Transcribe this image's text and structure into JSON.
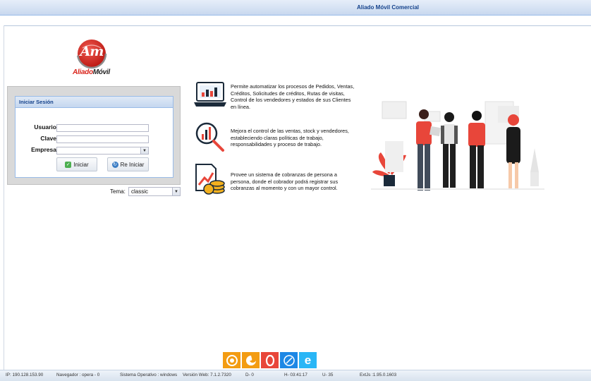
{
  "window": {
    "title": "Aliado Móvil Comercial"
  },
  "logo": {
    "monogram": "Am",
    "text_a": "Aliado",
    "text_b": "Móvil"
  },
  "login": {
    "panel_title": "Iniciar Sesión",
    "user_label": "Usuario",
    "user_value": "",
    "pass_label": "Clave",
    "pass_value": "",
    "company_label": "Empresa",
    "company_value": "",
    "start_button": "Iniciar",
    "restart_button": "Re Iniciar",
    "theme_label": "Tema:",
    "theme_value": "classic"
  },
  "features": [
    {
      "icon": "laptop-chart-icon",
      "text": "Permite automatizar los procesos de Pedidos, Ventas, Créditos, Solicitudes de créditos, Rutas de visitas, Control de los vendedores y estados de sus Clientes en línea."
    },
    {
      "icon": "magnifier-chart-icon",
      "text": "Mejora el control de las ventas, stock y vendedores, estableciendo claras políticas de trabajo, responsabilidades y proceso de trabajo."
    },
    {
      "icon": "invoice-coins-icon",
      "text": "Provee un sistema de cobranzas de persona a persona, donde el cobrador podrá registrar sus cobranzas al momento y con un mayor control."
    }
  ],
  "colors": {
    "accent": "#15428b",
    "brand_red": "#d9251c",
    "footer_bg": "#dde6f1"
  },
  "browsers": [
    "chrome-icon",
    "firefox-icon",
    "opera-icon",
    "safari-icon",
    "edge-icon"
  ],
  "footer": {
    "ip": "IP: 190.128.153.90",
    "browser": "Navegador : opera - 0",
    "os": "Sistema Operativo : windows",
    "version": "Versión Web: 7.1.2.7320",
    "d": "D- 0",
    "h": "H- 03:41:17",
    "u": "U- 35",
    "extjs": "ExtJs :1.95.0.1603"
  }
}
